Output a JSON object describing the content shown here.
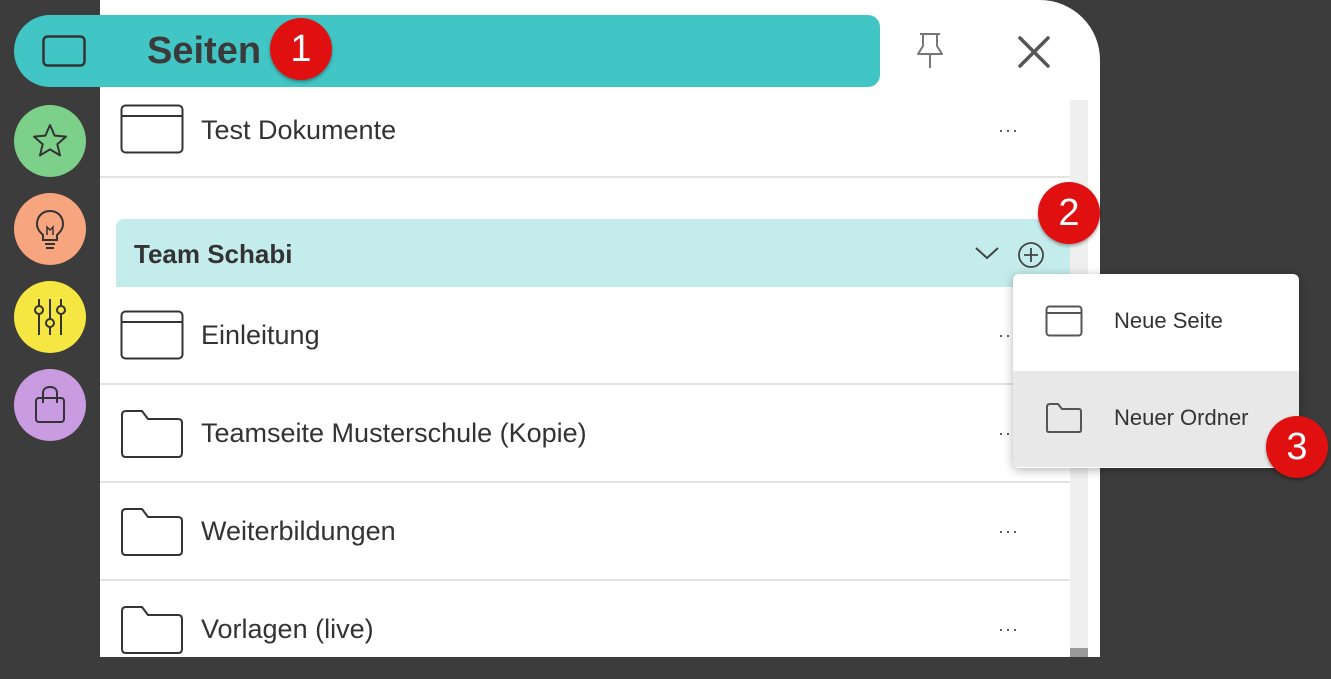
{
  "header": {
    "title": "Seiten"
  },
  "badges": [
    "1",
    "2",
    "3"
  ],
  "rail": {
    "items": [
      {
        "icon": "star-icon",
        "color": "#7dd08a"
      },
      {
        "icon": "lightbulb-icon",
        "color": "#f7a57e"
      },
      {
        "icon": "sliders-icon",
        "color": "#f5e642"
      },
      {
        "icon": "shopping-bag-icon",
        "color": "#c99be0"
      }
    ]
  },
  "pages_top": [
    {
      "label": "Test Dokumente",
      "icon": "page-icon",
      "menu": "···"
    }
  ],
  "section": {
    "title": "Team Schabi",
    "items": [
      {
        "label": "Einleitung",
        "icon": "page-icon",
        "menu": "···"
      },
      {
        "label": "Teamseite Musterschule (Kopie)",
        "icon": "folder-icon",
        "menu": "···"
      },
      {
        "label": "Weiterbildungen",
        "icon": "folder-icon",
        "menu": "···"
      },
      {
        "label": "Vorlagen (live)",
        "icon": "folder-icon",
        "menu": "···"
      }
    ]
  },
  "add_menu": {
    "items": [
      {
        "label": "Neue Seite",
        "icon": "page-icon"
      },
      {
        "label": "Neuer Ordner",
        "icon": "folder-icon"
      }
    ]
  },
  "colors": {
    "accent": "#42c5c5",
    "section_bg": "#c5ecec",
    "badge": "#e01010",
    "background": "#3c3c3c"
  }
}
